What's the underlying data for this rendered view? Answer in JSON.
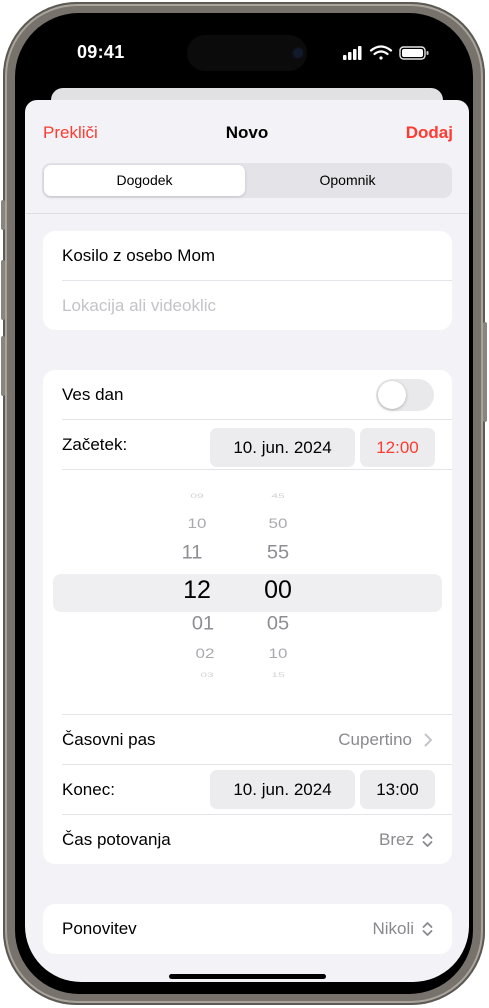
{
  "status_bar": {
    "time": "09:41"
  },
  "nav": {
    "cancel": "Prekliči",
    "title": "Novo",
    "add": "Dodaj"
  },
  "segments": [
    "Dogodek",
    "Opomnik"
  ],
  "event": {
    "title_value": "Kosilo z osebo Mom",
    "location_placeholder": "Lokacija ali videoklic"
  },
  "all_day": {
    "label": "Ves dan",
    "on": false
  },
  "start": {
    "label": "Začetek:",
    "date": "10. jun. 2024",
    "time": "12:00"
  },
  "picker": {
    "hours": [
      "09",
      "10",
      "11",
      "12",
      "01",
      "02",
      "03"
    ],
    "minutes": [
      "45",
      "50",
      "55",
      "00",
      "05",
      "10",
      "15"
    ]
  },
  "timezone": {
    "label": "Časovni pas",
    "value": "Cupertino"
  },
  "end": {
    "label": "Konec:",
    "date": "10. jun. 2024",
    "time": "13:00"
  },
  "travel": {
    "label": "Čas potovanja",
    "value": "Brez"
  },
  "repeat": {
    "label": "Ponovitev",
    "value": "Nikoli"
  },
  "colors": {
    "accent": "#ff3b30",
    "background": "#f2f2f7"
  }
}
